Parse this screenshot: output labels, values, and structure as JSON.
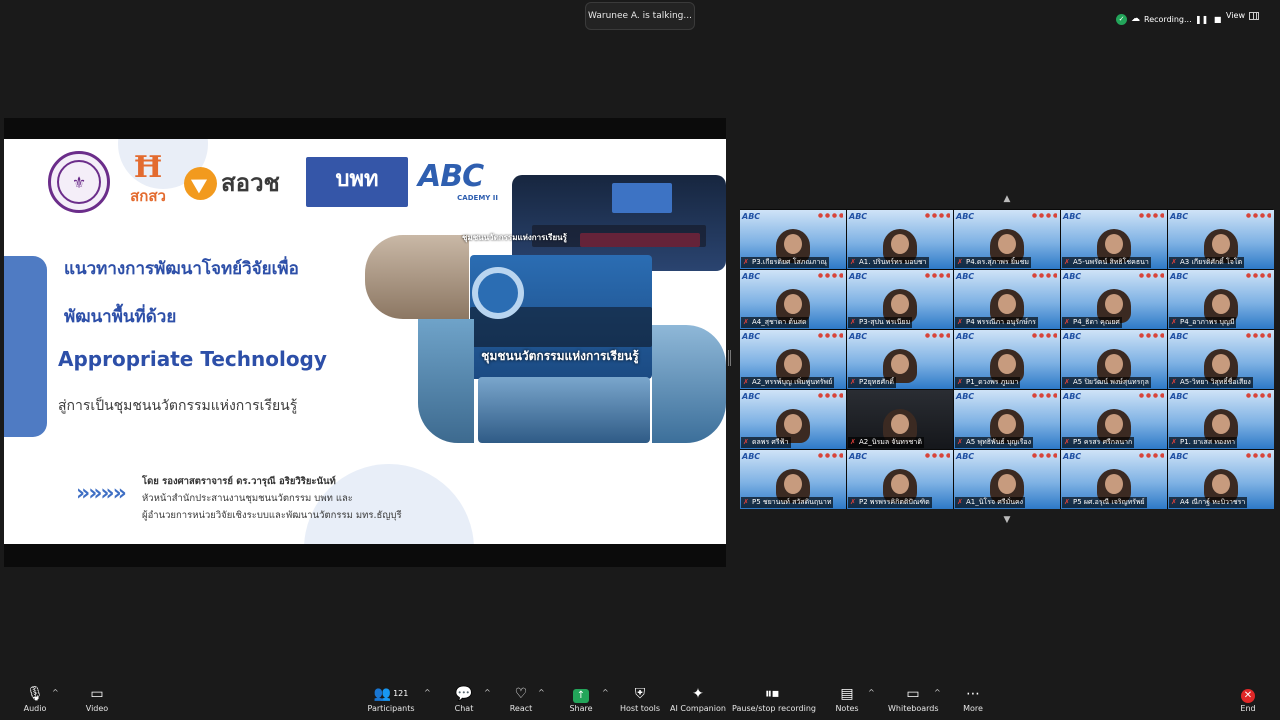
{
  "topbar": {
    "talking": "Warunee A. is talking...",
    "recording_label": "Recording...",
    "view_label": "View"
  },
  "slide": {
    "logo_tsri_text": "สกสว",
    "logo_nriis_text": "สอวช",
    "logo_pmu_text": "บพท",
    "logo_abc_text": "ABC",
    "logo_abc_sub": "CADEMY II",
    "heading_line1": "แนวทางการพัฒนาโจทย์วิจัยเพื่อ",
    "heading_line2": "พัฒนาพื้นที่ด้วย",
    "heading_line3": "Appropriate Technology",
    "subline": "สู่การเป็นชุมชนนวัตกรรมแห่งการเรียนรู้",
    "photo_caption": "ชุมชนนวัตกรรมแห่งการเรียนรู้",
    "photo_caption_small": "ชุมชนนวัตกรรมแห่งการเรียนรู้",
    "arrows": "»»»»",
    "author_name": "โดย รองศาสตราจารย์ ดร.วารุณี  อริยวิริยะนันท์",
    "author_line2": "หัวหน้าสำนักประสานงานชุมชนนวัตกรรม บพท และ",
    "author_line3": "ผู้อำนวยการหน่วยวิจัยเชิงระบบและพัฒนานวัตกรรม มทร.ธัญบุรี"
  },
  "gallery": {
    "tiles": [
      {
        "label": "P3.เกียรติยศ โสภณภาณุ"
      },
      {
        "label": "A1. ปรินทร์ทร มอบชา"
      },
      {
        "label": "P4.ดร.สุภาพร ยิ้มชม"
      },
      {
        "label": "A5-นพรัตน์ สิทธิโชคธนา"
      },
      {
        "label": "A3 เกียรติศักดิ์ โจโต"
      },
      {
        "label": "A4_สุชาดา ต้นสด"
      },
      {
        "label": "P3-สุปน พรเนียม"
      },
      {
        "label": "P4 พรรณีภา อนุรักษ์กร"
      },
      {
        "label": "P4_ธิดา คุณยศ"
      },
      {
        "label": "P4_อาภาพร บุญมี"
      },
      {
        "label": "A2_ทรรพ์บุญ เพิ่มพูนทรัพย์"
      },
      {
        "label": "P2ยุทธศักดิ์"
      },
      {
        "label": "P1_ดวงพร ภูมมา"
      },
      {
        "label": "A5 ปิยวัฒน์ พงษ์สุนทรกุล"
      },
      {
        "label": "A5-วิทยา วิสุทธิ์ชื่อเสียง"
      },
      {
        "label": "ดลพร ศรีฟ้า"
      },
      {
        "label": "A2_นิรมล จันทรชาติ"
      },
      {
        "label": "A5 พุทธิพันธ์ บุญเรือง"
      },
      {
        "label": "P5 ครสร ศรีกลนาก"
      },
      {
        "label": "P1. ยาเสส ทองทา"
      },
      {
        "label": "P5 ชยานนท์ สวัสดินฤนาท"
      },
      {
        "label": "P2 พรพรรคิกิตติปัณฑิต"
      },
      {
        "label": "A1_นิโรจ ศรีมั่นคง"
      },
      {
        "label": "P5 ผศ.อรุณี เจริญทรัพย์"
      },
      {
        "label": "A4 ณีกาฐ์ หะบิวาชรา"
      }
    ]
  },
  "toolbar": {
    "audio": "Audio",
    "video": "Video",
    "participants": "Participants",
    "participants_count": "121",
    "chat": "Chat",
    "react": "React",
    "share": "Share",
    "host_tools": "Host tools",
    "ai_companion": "AI Companion",
    "pause_recording": "Pause/stop recording",
    "notes": "Notes",
    "whiteboards": "Whiteboards",
    "more": "More",
    "end": "End"
  }
}
